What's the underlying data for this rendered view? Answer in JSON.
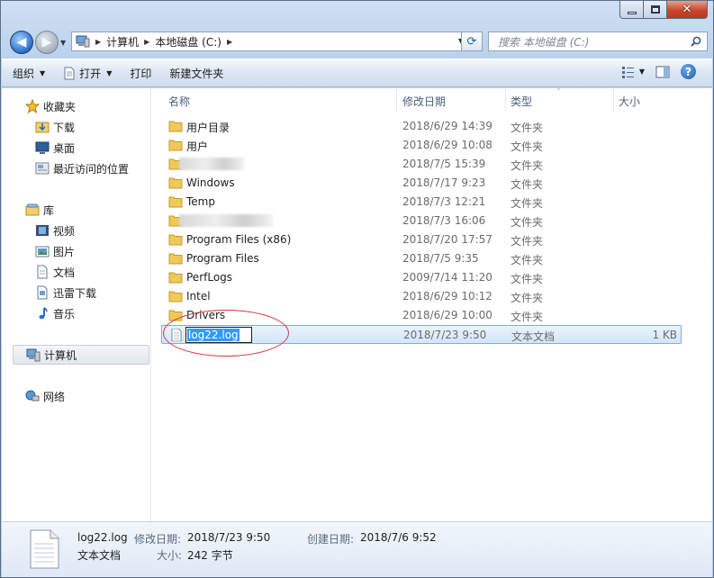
{
  "window": {
    "min_glyph": "–",
    "close_glyph": "✕"
  },
  "address": {
    "crumbs": [
      "计算机",
      "本地磁盘 (C:)"
    ],
    "search_placeholder": "搜索 本地磁盘 (C:)"
  },
  "toolbar": {
    "organize": "组织",
    "open": "打开",
    "print": "打印",
    "new_folder": "新建文件夹",
    "help": "?"
  },
  "nav": {
    "favorites": "收藏夹",
    "downloads": "下载",
    "desktop": "桌面",
    "recent": "最近访问的位置",
    "libraries": "库",
    "videos": "视频",
    "pictures": "图片",
    "documents": "文档",
    "xunlei": "迅雷下载",
    "music": "音乐",
    "computer": "计算机",
    "network": "网络"
  },
  "columns": {
    "name": "名称",
    "date": "修改日期",
    "type": "类型",
    "size": "大小"
  },
  "files": [
    {
      "name": "用户目录",
      "date": "2018/6/29 14:39",
      "type": "文件夹",
      "size": ""
    },
    {
      "name": "用户",
      "date": "2018/6/29 10:08",
      "type": "文件夹",
      "size": ""
    },
    {
      "name": "",
      "date": "2018/7/5 15:39",
      "type": "文件夹",
      "size": ""
    },
    {
      "name": "Windows",
      "date": "2018/7/17 9:23",
      "type": "文件夹",
      "size": ""
    },
    {
      "name": "Temp",
      "date": "2018/7/3 12:21",
      "type": "文件夹",
      "size": ""
    },
    {
      "name": "",
      "date": "2018/7/3 16:06",
      "type": "文件夹",
      "size": ""
    },
    {
      "name": "Program Files (x86)",
      "date": "2018/7/20 17:57",
      "type": "文件夹",
      "size": ""
    },
    {
      "name": "Program Files",
      "date": "2018/7/5 9:35",
      "type": "文件夹",
      "size": ""
    },
    {
      "name": "PerfLogs",
      "date": "2009/7/14 11:20",
      "type": "文件夹",
      "size": ""
    },
    {
      "name": "Intel",
      "date": "2018/6/29 10:12",
      "type": "文件夹",
      "size": ""
    },
    {
      "name": "Drivers",
      "date": "2018/6/29 10:00",
      "type": "文件夹",
      "size": ""
    },
    {
      "name": "log22.log",
      "date": "2018/7/23 9:50",
      "type": "文本文档",
      "size": "1 KB"
    }
  ],
  "details": {
    "filename": "log22.log",
    "filetype": "文本文档",
    "modified_label": "修改日期:",
    "modified_value": "2018/7/23 9:50",
    "created_label": "创建日期:",
    "created_value": "2018/7/6 9:52",
    "size_label": "大小:",
    "size_value": "242 字节"
  }
}
